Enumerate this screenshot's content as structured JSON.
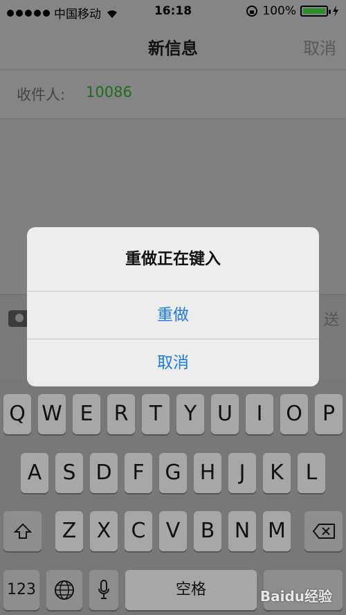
{
  "status_bar": {
    "carrier": "中国移动",
    "time": "16:18",
    "battery": "100%"
  },
  "nav": {
    "title": "新信息",
    "cancel": "取消"
  },
  "recipient": {
    "label": "收件人:",
    "value": "10086"
  },
  "compose": {
    "send": "送"
  },
  "keyboard": {
    "row1": [
      "Q",
      "W",
      "E",
      "R",
      "T",
      "Y",
      "U",
      "I",
      "O",
      "P"
    ],
    "row2": [
      "A",
      "S",
      "D",
      "F",
      "G",
      "H",
      "J",
      "K",
      "L"
    ],
    "row3": [
      "Z",
      "X",
      "C",
      "V",
      "B",
      "N",
      "M"
    ],
    "numbers": "123",
    "space": "空格"
  },
  "alert": {
    "title": "重做正在键入",
    "redo": "重做",
    "cancel": "取消"
  },
  "watermark": "Baidu经验"
}
